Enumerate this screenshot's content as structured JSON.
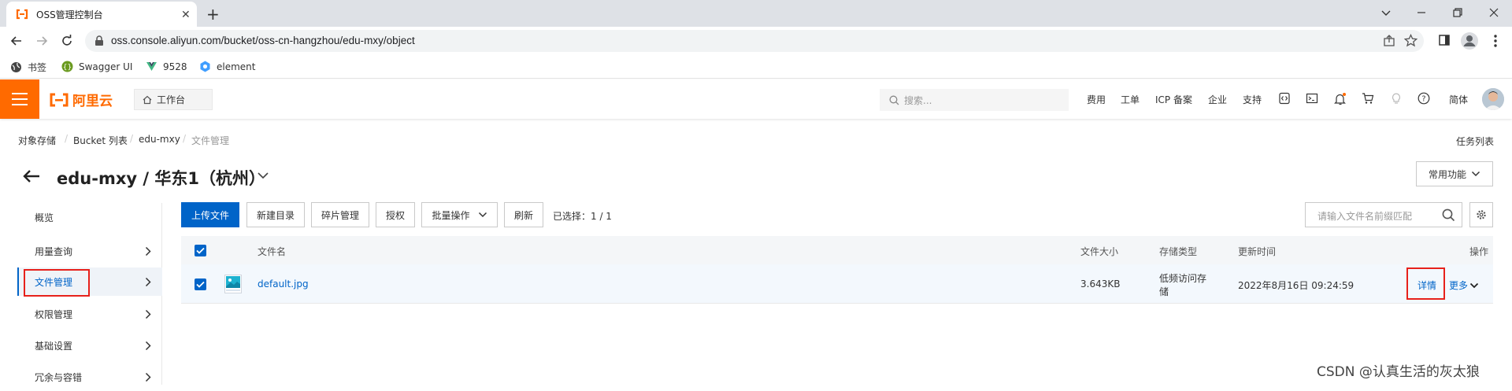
{
  "browser": {
    "tab_title": "OSS管理控制台",
    "url": "oss.console.aliyun.com/bucket/oss-cn-hangzhou/edu-mxy/object",
    "bookmarks": [
      {
        "label": "书签",
        "icon": "globe-icon"
      },
      {
        "label": "Swagger UI",
        "icon": "swagger-icon"
      },
      {
        "label": "9528",
        "icon": "vue-icon"
      },
      {
        "label": "element",
        "icon": "element-icon"
      }
    ]
  },
  "topnav": {
    "logo_text": "阿里云",
    "workbench": "工作台",
    "search_placeholder": "搜索...",
    "links": [
      "费用",
      "工单",
      "ICP 备案",
      "企业",
      "支持"
    ],
    "lang": "简体",
    "brand_color": "#ff6a00"
  },
  "breadcrumb": [
    "对象存储",
    "Bucket 列表",
    "edu-mxy",
    "文件管理"
  ],
  "header": {
    "title": "edu-mxy / 华东1（杭州）",
    "task_list": "任务列表",
    "common_functions": "常用功能"
  },
  "sidebar": {
    "items": [
      {
        "label": "概览",
        "has_chevron": false
      },
      {
        "label": "用量查询",
        "has_chevron": true
      },
      {
        "label": "文件管理",
        "has_chevron": true,
        "active": true
      },
      {
        "label": "权限管理",
        "has_chevron": true
      },
      {
        "label": "基础设置",
        "has_chevron": true
      },
      {
        "label": "冗余与容错",
        "has_chevron": true
      }
    ]
  },
  "toolbar": {
    "upload": "上传文件",
    "new_dir": "新建目录",
    "fragments": "碎片管理",
    "authorize": "授权",
    "batch": "批量操作",
    "refresh": "刷新",
    "selected": "已选择：1 / 1",
    "search_placeholder": "请输入文件名前缀匹配"
  },
  "table": {
    "headers": {
      "name": "文件名",
      "size": "文件大小",
      "storage": "存储类型",
      "updated": "更新时间",
      "actions": "操作"
    },
    "rows": [
      {
        "name": "default.jpg",
        "size": "3.643KB",
        "storage_line1": "低频访问存",
        "storage_line2": "储",
        "updated": "2022年8月16日 09:24:59",
        "detail": "详情",
        "more": "更多",
        "checked": true
      }
    ]
  },
  "watermark": "CSDN @认真生活的灰太狼",
  "accent_color": "#0064c8",
  "highlight_color": "#e7211b"
}
